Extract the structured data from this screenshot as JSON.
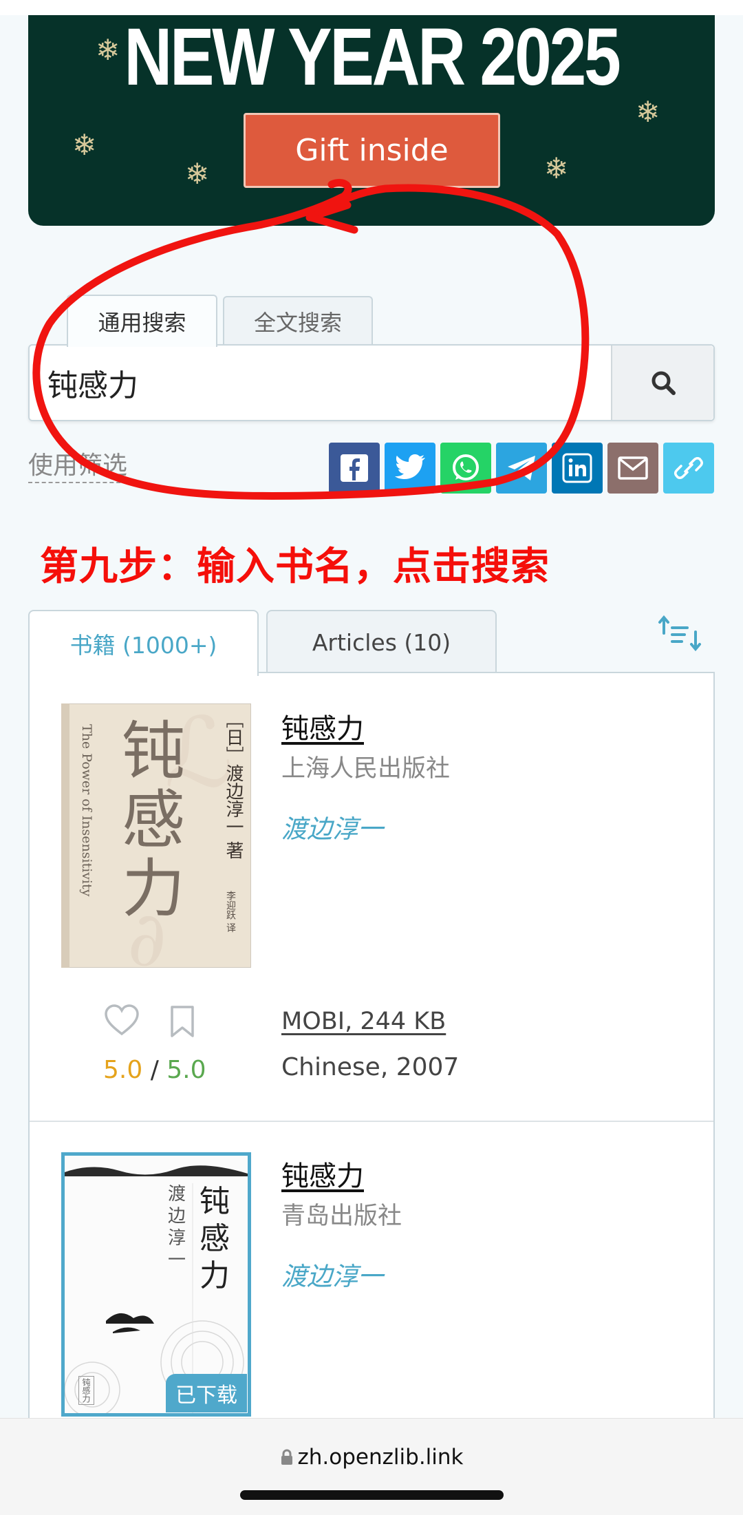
{
  "banner": {
    "title": "NEW YEAR 2025",
    "button": "Gift inside"
  },
  "search": {
    "tabs": [
      "通用搜索",
      "全文搜索"
    ],
    "query": "钝感力",
    "filters_link": "使用筛选"
  },
  "share_icons": [
    {
      "name": "facebook-icon",
      "color": "#3b5998"
    },
    {
      "name": "twitter-icon",
      "color": "#1da1f2"
    },
    {
      "name": "whatsapp-icon",
      "color": "#25d366"
    },
    {
      "name": "telegram-icon",
      "color": "#2ca5e0"
    },
    {
      "name": "linkedin-icon",
      "color": "#0077b5"
    },
    {
      "name": "email-icon",
      "color": "#8c6f6b"
    },
    {
      "name": "link-icon",
      "color": "#4dc9ee"
    }
  ],
  "annotation": "第九步：输入书名，点击搜索",
  "results": {
    "tabs": [
      "书籍 (1000+)",
      "Articles (10)"
    ],
    "books": [
      {
        "title": "钝感力",
        "publisher": "上海人民出版社",
        "author": "渡边淳一",
        "file": "MOBI, 244 KB",
        "lang_year": "Chinese, 2007",
        "rating_q": "5.0",
        "rating_sep": " / ",
        "rating_v": "5.0",
        "cover": {
          "en": "The Power of Insensitivity",
          "title": "钝感力",
          "author": "［日］渡边淳一 著",
          "translator": "李迎跃 译"
        }
      },
      {
        "title": "钝感力",
        "publisher": "青岛出版社",
        "author": "渡边淳一",
        "badge": "已下载",
        "cover": {
          "title": "钝感力",
          "author": "渡边淳一",
          "spine": "钝感力"
        }
      }
    ]
  },
  "browser": {
    "url": "zh.openzlib.link"
  },
  "colors": {
    "banner_bg": "#063229",
    "gift_button": "#de5a3d",
    "accent": "#49a7c7",
    "annotation_red": "#f50f0a"
  }
}
